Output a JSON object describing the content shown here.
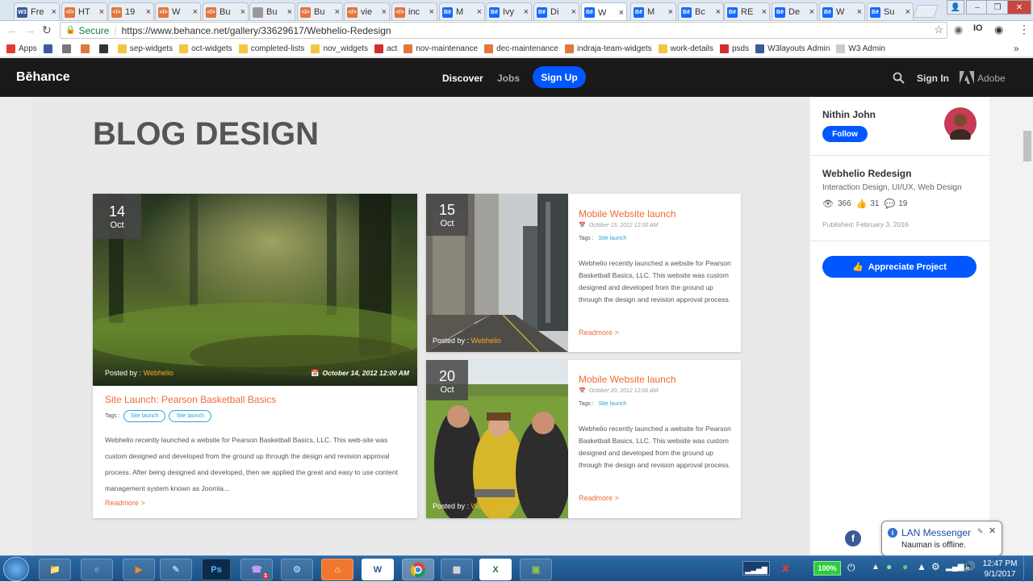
{
  "tabs": [
    {
      "label": "Fre",
      "fav": "W3",
      "color": "#3c5a99"
    },
    {
      "label": "HT",
      "fav": "</>",
      "color": "#e2763d"
    },
    {
      "label": "19",
      "fav": "</>",
      "color": "#e2763d"
    },
    {
      "label": "W",
      "fav": "</>",
      "color": "#e2763d"
    },
    {
      "label": "Bu",
      "fav": "</>",
      "color": "#e2763d"
    },
    {
      "label": "Bu",
      "fav": "",
      "color": "#999999"
    },
    {
      "label": "Bu",
      "fav": "</>",
      "color": "#e2763d"
    },
    {
      "label": "vie",
      "fav": "</>",
      "color": "#e2763d"
    },
    {
      "label": "inc",
      "fav": "</>",
      "color": "#e2763d"
    },
    {
      "label": "M",
      "fav": "Bē",
      "color": "#1769ff"
    },
    {
      "label": "Ivy",
      "fav": "Bē",
      "color": "#1769ff"
    },
    {
      "label": "Di",
      "fav": "Bē",
      "color": "#1769ff"
    },
    {
      "label": "W",
      "fav": "Bē",
      "color": "#1769ff"
    },
    {
      "label": "M",
      "fav": "Bē",
      "color": "#1769ff"
    },
    {
      "label": "Bc",
      "fav": "Bē",
      "color": "#1769ff"
    },
    {
      "label": "RE",
      "fav": "Bē",
      "color": "#1769ff"
    },
    {
      "label": "De",
      "fav": "Bē",
      "color": "#1769ff"
    },
    {
      "label": "W",
      "fav": "Bē",
      "color": "#1769ff"
    },
    {
      "label": "Su",
      "fav": "Bē",
      "color": "#1769ff"
    }
  ],
  "address": {
    "secure_label": "Secure",
    "url": "https://www.behance.net/gallery/33629617/Webhelio-Redesign"
  },
  "bookmarks": [
    {
      "label": "Apps",
      "color": "#e53935"
    },
    {
      "label": "",
      "color": "#3c5a99"
    },
    {
      "label": "",
      "color": "#777777"
    },
    {
      "label": "",
      "color": "#e2763d"
    },
    {
      "label": "",
      "color": "#333333"
    },
    {
      "label": "sep-widgets",
      "color": "#f5c542"
    },
    {
      "label": "oct-widgets",
      "color": "#f5c542"
    },
    {
      "label": "completed-lists",
      "color": "#f5c542"
    },
    {
      "label": "nov_widgets",
      "color": "#f5c542"
    },
    {
      "label": "act",
      "color": "#d32f2f"
    },
    {
      "label": "nov-maintenance",
      "color": "#e2763d"
    },
    {
      "label": "dec-maintenance",
      "color": "#e2763d"
    },
    {
      "label": "indraja-team-widgets",
      "color": "#e2763d"
    },
    {
      "label": "work-details",
      "color": "#f5c542"
    },
    {
      "label": "psds",
      "color": "#d32f2f"
    },
    {
      "label": "W3layouts Admin",
      "color": "#3c5a99"
    },
    {
      "label": "W3 Admin",
      "color": "#cccccc"
    }
  ],
  "bookmarks_more": "»",
  "behance": {
    "logo": "Bēhance",
    "nav_discover": "Discover",
    "nav_jobs": "Jobs",
    "signup": "Sign Up",
    "signin": "Sign In",
    "adobe": "Adobe"
  },
  "blog": {
    "heading": "BLOG DESIGN",
    "main_post": {
      "day": "14",
      "month": "Oct",
      "posted_by_label": "Posted by : ",
      "author": "Webhelio",
      "date": "October 14, 2012 12:00 AM",
      "title": "Site Launch: Pearson Basketball Basics",
      "tags_label": "Tags :",
      "tags": [
        "Site launch",
        "Site launch"
      ],
      "body": "Webhelio recently launched a website for Pearson Basketball Basics, LLC. This web-site was custom designed and developed from the ground up through the design and revision approval process. After being designed and developed, then we applied the great and easy to use content management system known as Joomla...",
      "readmore": "Readmore >"
    },
    "side_posts": [
      {
        "day": "15",
        "month": "Oct",
        "posted_by_label": "Posted by : ",
        "author": "Webhelio",
        "title": "Mobile Website launch",
        "date": "October 15, 2012 12:00 AM",
        "tags_label": "Tags :",
        "tag": "Site launch",
        "body": "Webhelio recently launched a website for Pearson Basketball Basics, LLC. This website was custom designed and developed from the ground up through the design and revision approval process.",
        "readmore": "Readmore >"
      },
      {
        "day": "20",
        "month": "Oct",
        "posted_by_label": "Posted by : ",
        "author": "Webhelio",
        "title": "Mobile Website launch",
        "date": "October 20, 2012 12:00 AM",
        "tags_label": "Tags :",
        "tag": "Site launch",
        "body": "Webhelio recently launched a website for Pearson Basketball Basics, LLC. This website was custom designed and developed from the ground up through the design and revision approval process.",
        "readmore": "Readmore >"
      }
    ]
  },
  "sidebar": {
    "owner": "Nithin John",
    "follow": "Follow",
    "project_title": "Webhelio Redesign",
    "fields": "Interaction Design, UI/UX, Web Design",
    "views": "366",
    "appreciations": "31",
    "comments": "19",
    "published": "Published: February 3, 2016",
    "appreciate_btn": "Appreciate Project"
  },
  "messenger": {
    "title": "LAN Messenger",
    "message": "Nauman is offline."
  },
  "taskbar": {
    "battery": "100%",
    "time": "12:47 PM",
    "date": "9/1/2017",
    "badge": "1"
  },
  "colors": {
    "accent_orange": "#ee6b37",
    "behance_blue": "#0057ff",
    "tag_blue": "#2aa3d8"
  }
}
